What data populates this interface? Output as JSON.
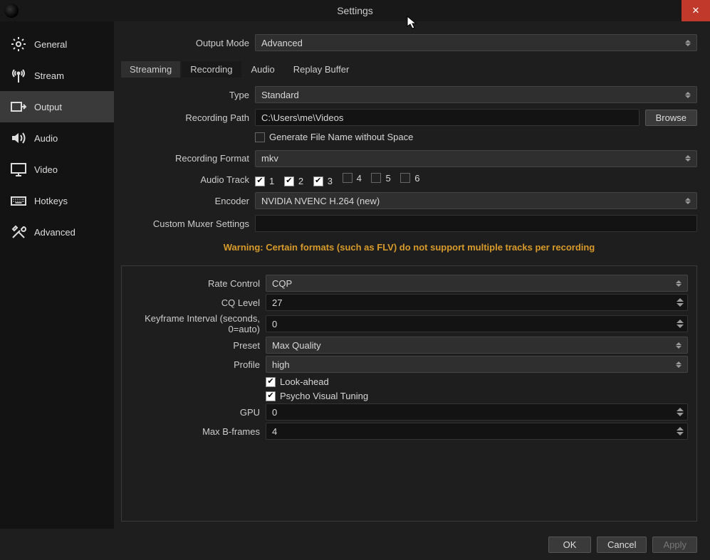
{
  "window": {
    "title": "Settings",
    "close_glyph": "✕"
  },
  "sidebar": {
    "items": [
      {
        "label": "General",
        "icon": "gear"
      },
      {
        "label": "Stream",
        "icon": "antenna"
      },
      {
        "label": "Output",
        "icon": "output",
        "active": true
      },
      {
        "label": "Audio",
        "icon": "speaker"
      },
      {
        "label": "Video",
        "icon": "monitor"
      },
      {
        "label": "Hotkeys",
        "icon": "keyboard"
      },
      {
        "label": "Advanced",
        "icon": "tools"
      }
    ]
  },
  "output_mode": {
    "label": "Output Mode",
    "value": "Advanced"
  },
  "tabs": [
    {
      "label": "Streaming"
    },
    {
      "label": "Recording",
      "active": true
    },
    {
      "label": "Audio"
    },
    {
      "label": "Replay Buffer"
    }
  ],
  "recording": {
    "type": {
      "label": "Type",
      "value": "Standard"
    },
    "path": {
      "label": "Recording Path",
      "value": "C:\\Users\\me\\Videos",
      "browse": "Browse"
    },
    "gen_no_space": {
      "label": "Generate File Name without Space",
      "checked": false
    },
    "format": {
      "label": "Recording Format",
      "value": "mkv"
    },
    "audio_track": {
      "label": "Audio Track",
      "tracks": [
        {
          "n": "1",
          "checked": true
        },
        {
          "n": "2",
          "checked": true
        },
        {
          "n": "3",
          "checked": true
        },
        {
          "n": "4",
          "checked": false
        },
        {
          "n": "5",
          "checked": false
        },
        {
          "n": "6",
          "checked": false
        }
      ]
    },
    "encoder": {
      "label": "Encoder",
      "value": "NVIDIA NVENC H.264 (new)"
    },
    "muxer": {
      "label": "Custom Muxer Settings",
      "value": ""
    },
    "warning": "Warning: Certain formats (such as FLV) do not support multiple tracks per recording"
  },
  "encoder_panel": {
    "rate_control": {
      "label": "Rate Control",
      "value": "CQP"
    },
    "cq_level": {
      "label": "CQ Level",
      "value": "27"
    },
    "keyframe": {
      "label": "Keyframe Interval (seconds, 0=auto)",
      "value": "0"
    },
    "preset": {
      "label": "Preset",
      "value": "Max Quality"
    },
    "profile": {
      "label": "Profile",
      "value": "high"
    },
    "lookahead": {
      "label": "Look-ahead",
      "checked": true
    },
    "psycho": {
      "label": "Psycho Visual Tuning",
      "checked": true
    },
    "gpu": {
      "label": "GPU",
      "value": "0"
    },
    "max_b": {
      "label": "Max B-frames",
      "value": "4"
    }
  },
  "footer": {
    "ok": "OK",
    "cancel": "Cancel",
    "apply": "Apply"
  }
}
